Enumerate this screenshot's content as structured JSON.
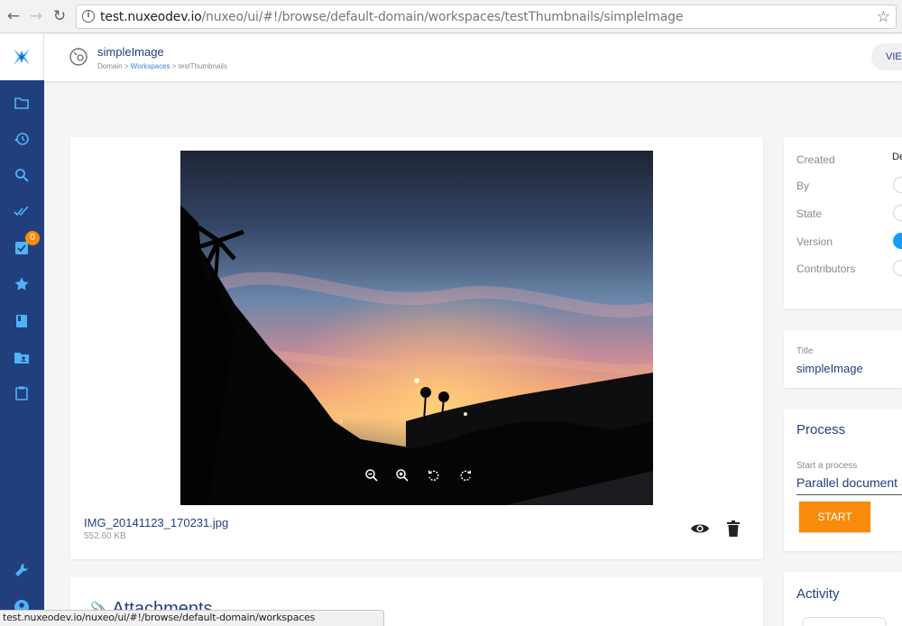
{
  "browser": {
    "url_host": "test.nuxeodev.io",
    "url_path": "/nuxeo/ui/#!/browse/default-domain/workspaces/testThumbnails/simpleImage",
    "back_icon": "arrow-left-icon",
    "forward_icon": "arrow-right-icon",
    "reload_icon": "reload-icon",
    "bookmark_icon": "star-outline-icon"
  },
  "sidebar": {
    "logo_icon": "nuxeo-x-logo-icon",
    "items": [
      {
        "icon": "folder-icon"
      },
      {
        "icon": "history-icon"
      },
      {
        "icon": "search-icon"
      },
      {
        "icon": "double-check-icon"
      },
      {
        "icon": "tasks-checkbox-icon",
        "badge": "0"
      },
      {
        "icon": "star-icon"
      },
      {
        "icon": "book-icon"
      },
      {
        "icon": "shared-folder-icon"
      },
      {
        "icon": "clipboard-icon"
      },
      {
        "icon": "wrench-icon"
      },
      {
        "icon": "user-icon"
      }
    ]
  },
  "header": {
    "title": "simpleImage",
    "breadcrumb": {
      "root": "Domain",
      "sep1": " > ",
      "link": "Workspaces",
      "sep2": " > ",
      "leaf": "testThumbnails"
    },
    "view_button": "VIEW"
  },
  "viewer": {
    "file_name": "IMG_20141123_170231.jpg",
    "file_size": "552.60 KB",
    "tools": [
      "zoom-out-icon",
      "zoom-in-icon",
      "rotate-left-icon",
      "rotate-right-icon"
    ]
  },
  "attachments": {
    "title": "Attachments"
  },
  "metadata": {
    "created_label": "Created",
    "created_value": "De",
    "by_label": "By",
    "state_label": "State",
    "version_label": "Version",
    "contributors_label": "Contributors"
  },
  "title_field": {
    "label": "Title",
    "value": "simpleImage"
  },
  "process": {
    "title": "Process",
    "start_label": "Start a process",
    "selected": "Parallel document review",
    "start_button": "START"
  },
  "activity": {
    "title": "Activity"
  },
  "status_bar": {
    "text": "test.nuxeodev.io/nuxeo/ui/#!/browse/default-domain/workspaces"
  },
  "colors": {
    "brand_navy": "#213f7d",
    "accent_orange": "#f88b0b",
    "link_blue": "#3a86d1",
    "version_blue": "#1a9cf0"
  }
}
